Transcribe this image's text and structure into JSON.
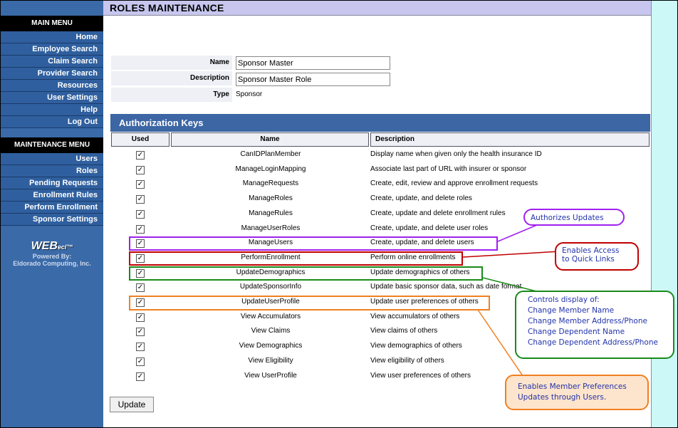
{
  "page": {
    "title": "ROLES MAINTENANCE"
  },
  "sidebar": {
    "main_menu_title": "MAIN MENU",
    "main_items": [
      "Home",
      "Employee Search",
      "Claim Search",
      "Provider Search",
      "Resources",
      "User Settings",
      "Help",
      "Log Out"
    ],
    "maintenance_menu_title": "MAINTENANCE MENU",
    "maintenance_items": [
      "Users",
      "Roles",
      "Pending Requests",
      "Enrollment Rules",
      "Perform Enrollment",
      "Sponsor Settings"
    ],
    "logo": {
      "brand": "WEB",
      "brand_suffix": "ecl",
      "tm": "™",
      "powered_by": "Powered By:",
      "company": "Eldorado Computing, Inc."
    }
  },
  "form": {
    "name_label": "Name",
    "name_value": "Sponsor Master",
    "description_label": "Description",
    "description_value": "Sponsor Master Role",
    "type_label": "Type",
    "type_value": "Sponsor"
  },
  "auth": {
    "header": "Authorization Keys",
    "columns": [
      "Used",
      "Name",
      "Description"
    ],
    "rows": [
      {
        "name": "CanIDPlanMember",
        "description": "Display name when given only the health insurance ID",
        "checked": true
      },
      {
        "name": "ManageLoginMapping",
        "description": "Associate last part of URL with insurer or sponsor",
        "checked": true
      },
      {
        "name": "ManageRequests",
        "description": "Create, edit, review and approve enrollment requests",
        "checked": true
      },
      {
        "name": "ManageRoles",
        "description": "Create, update, and delete roles",
        "checked": true
      },
      {
        "name": "ManageRules",
        "description": "Create, update and delete enrollment rules",
        "checked": true
      },
      {
        "name": "ManageUserRoles",
        "description": "Create, update, and delete user roles",
        "checked": true
      },
      {
        "name": "ManageUsers",
        "description": "Create, update, and delete users",
        "checked": true
      },
      {
        "name": "PerformEnrollment",
        "description": "Perform online enrollments",
        "checked": true
      },
      {
        "name": "UpdateDemographics",
        "description": "Update demographics of others",
        "checked": true
      },
      {
        "name": "UpdateSponsorInfo",
        "description": "Update basic sponsor data, such as date format",
        "checked": true
      },
      {
        "name": "UpdateUserProfile",
        "description": "Update user preferences of others",
        "checked": true
      },
      {
        "name": "View Accumulators",
        "description": "View accumulators of others",
        "checked": true
      },
      {
        "name": "View Claims",
        "description": "View claims of others",
        "checked": true
      },
      {
        "name": "View Demographics",
        "description": "View demographics of others",
        "checked": true
      },
      {
        "name": "View Eligibility",
        "description": "View eligibility of others",
        "checked": true
      },
      {
        "name": "View UserProfile",
        "description": "View user preferences of others",
        "checked": true
      }
    ],
    "check_glyph": "✓"
  },
  "callouts": {
    "authorizes": "Authorizes Updates",
    "enables_access": [
      "Enables Access",
      "to Quick Links"
    ],
    "controls_display": [
      "Controls display of:",
      "Change Member Name",
      "Change Member Address/Phone",
      "Change Dependent Name",
      "Change Dependent Address/Phone"
    ],
    "member_prefs": [
      "Enables Member Preferences",
      "Updates through Users."
    ]
  },
  "buttons": {
    "update": "Update"
  },
  "colors": {
    "sidebar": "#3a6aa8",
    "header_bar": "#3c66a4",
    "title_bar": "#c6c6ee",
    "right_strip": "#ccf8f8",
    "purple": "#a020f0",
    "red": "#c00000",
    "green": "#1a8a1a",
    "orange": "#f08020"
  }
}
